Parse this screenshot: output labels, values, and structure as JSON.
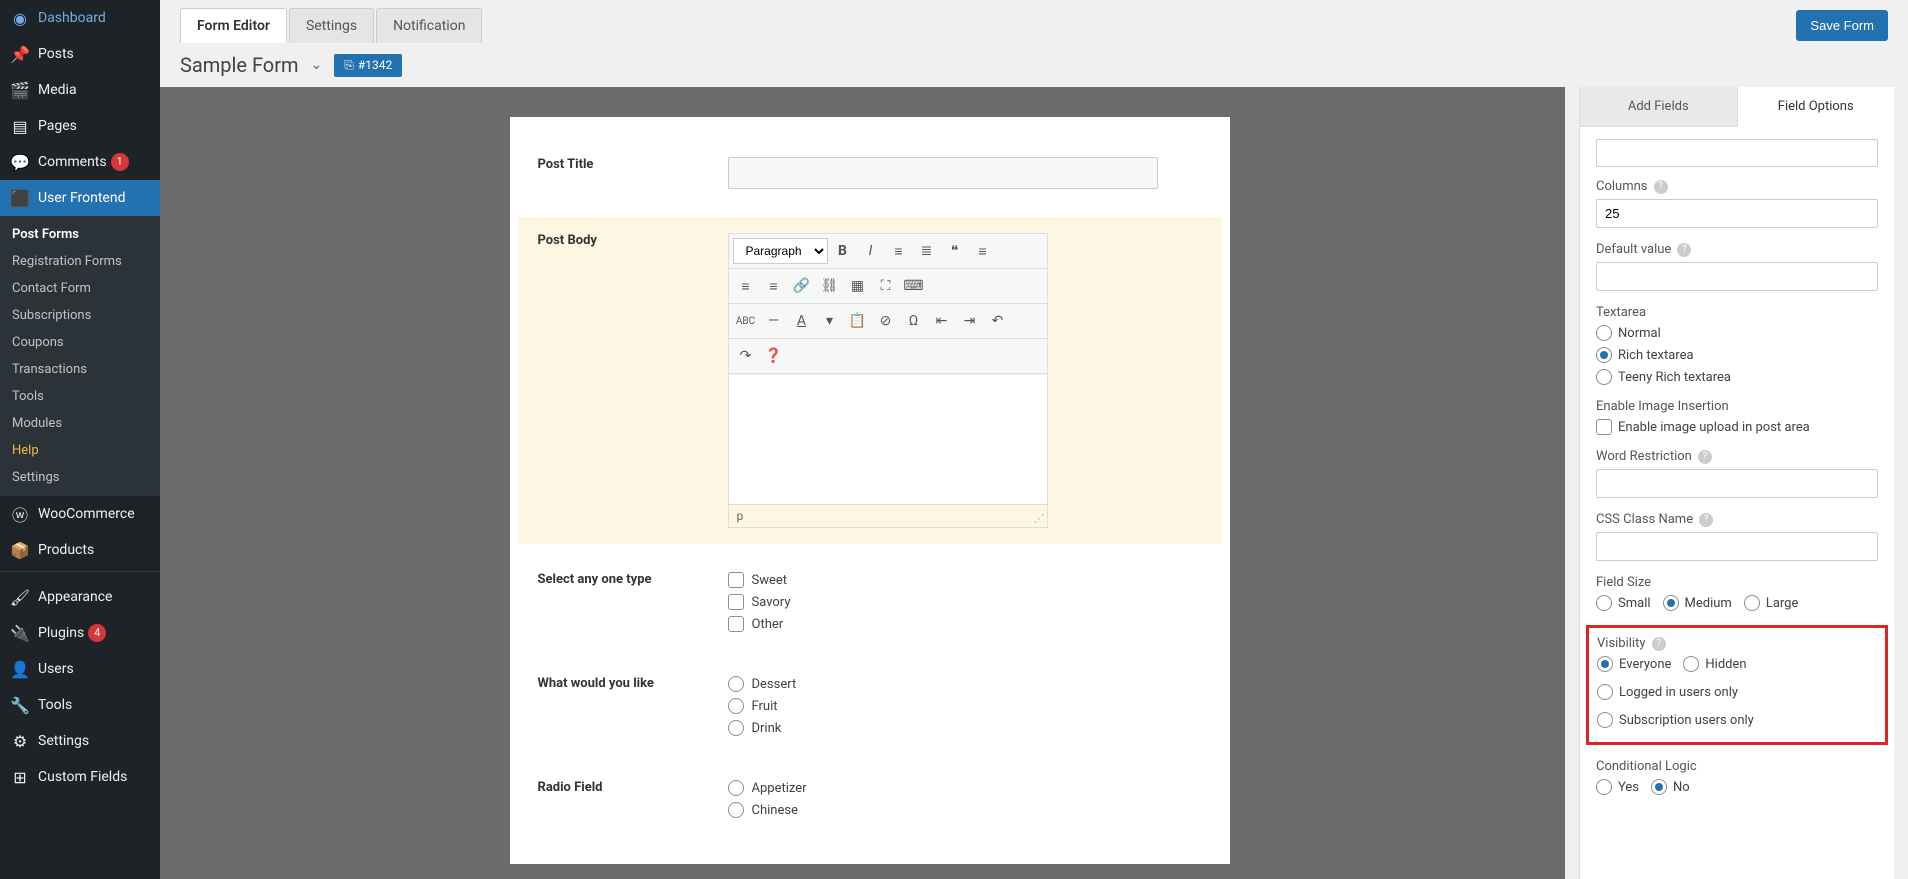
{
  "sidebar": {
    "items": [
      {
        "icon": "dashboard",
        "label": "Dashboard"
      },
      {
        "icon": "pin",
        "label": "Posts"
      },
      {
        "icon": "media",
        "label": "Media"
      },
      {
        "icon": "page",
        "label": "Pages"
      },
      {
        "icon": "comment",
        "label": "Comments",
        "badge": "1"
      },
      {
        "icon": "uf",
        "label": "User Frontend",
        "active": true
      },
      {
        "icon": "woo",
        "label": "WooCommerce"
      },
      {
        "icon": "product",
        "label": "Products"
      },
      {
        "icon": "appearance",
        "label": "Appearance"
      },
      {
        "icon": "plugin",
        "label": "Plugins",
        "badge": "4"
      },
      {
        "icon": "user",
        "label": "Users"
      },
      {
        "icon": "tool",
        "label": "Tools"
      },
      {
        "icon": "settings",
        "label": "Settings"
      },
      {
        "icon": "cf",
        "label": "Custom Fields"
      }
    ],
    "submenu": [
      {
        "label": "Post Forms",
        "current": true
      },
      {
        "label": "Registration Forms"
      },
      {
        "label": "Contact Form"
      },
      {
        "label": "Subscriptions"
      },
      {
        "label": "Coupons"
      },
      {
        "label": "Transactions"
      },
      {
        "label": "Tools"
      },
      {
        "label": "Modules"
      },
      {
        "label": "Help",
        "highlight": true
      },
      {
        "label": "Settings"
      }
    ]
  },
  "topbar": {
    "tabs": [
      {
        "label": "Form Editor",
        "active": true
      },
      {
        "label": "Settings"
      },
      {
        "label": "Notification"
      }
    ],
    "save_label": "Save Form"
  },
  "header": {
    "title": "Sample Form",
    "badge_id": "#1342"
  },
  "form": {
    "fields": {
      "post_title": "Post Title",
      "post_body": "Post Body",
      "format_select": "Paragraph",
      "status_path": "p",
      "checkbox": {
        "label": "Select any one type",
        "opts": [
          "Sweet",
          "Savory",
          "Other"
        ]
      },
      "radio1": {
        "label": "What would you like",
        "opts": [
          "Dessert",
          "Fruit",
          "Drink"
        ]
      },
      "radio2": {
        "label": "Radio Field",
        "opts": [
          "Appetizer",
          "Chinese"
        ]
      }
    }
  },
  "right": {
    "tabs": {
      "add": "Add Fields",
      "opts": "Field Options"
    },
    "columns": {
      "label": "Columns",
      "value": "25"
    },
    "default_value": {
      "label": "Default value"
    },
    "textarea": {
      "label": "Textarea",
      "opts": [
        "Normal",
        "Rich textarea",
        "Teeny Rich textarea"
      ],
      "selected": 1
    },
    "image_insert": {
      "label": "Enable Image Insertion",
      "chk": "Enable image upload in post area"
    },
    "word_restrict": {
      "label": "Word Restriction"
    },
    "css_class": {
      "label": "CSS Class Name"
    },
    "field_size": {
      "label": "Field Size",
      "opts": [
        "Small",
        "Medium",
        "Large"
      ],
      "selected": 1
    },
    "visibility": {
      "label": "Visibility",
      "opts": [
        "Everyone",
        "Hidden",
        "Logged in users only",
        "Subscription users only"
      ],
      "selected": 0
    },
    "conditional": {
      "label": "Conditional Logic",
      "opts": [
        "Yes",
        "No"
      ],
      "selected": 1
    }
  }
}
